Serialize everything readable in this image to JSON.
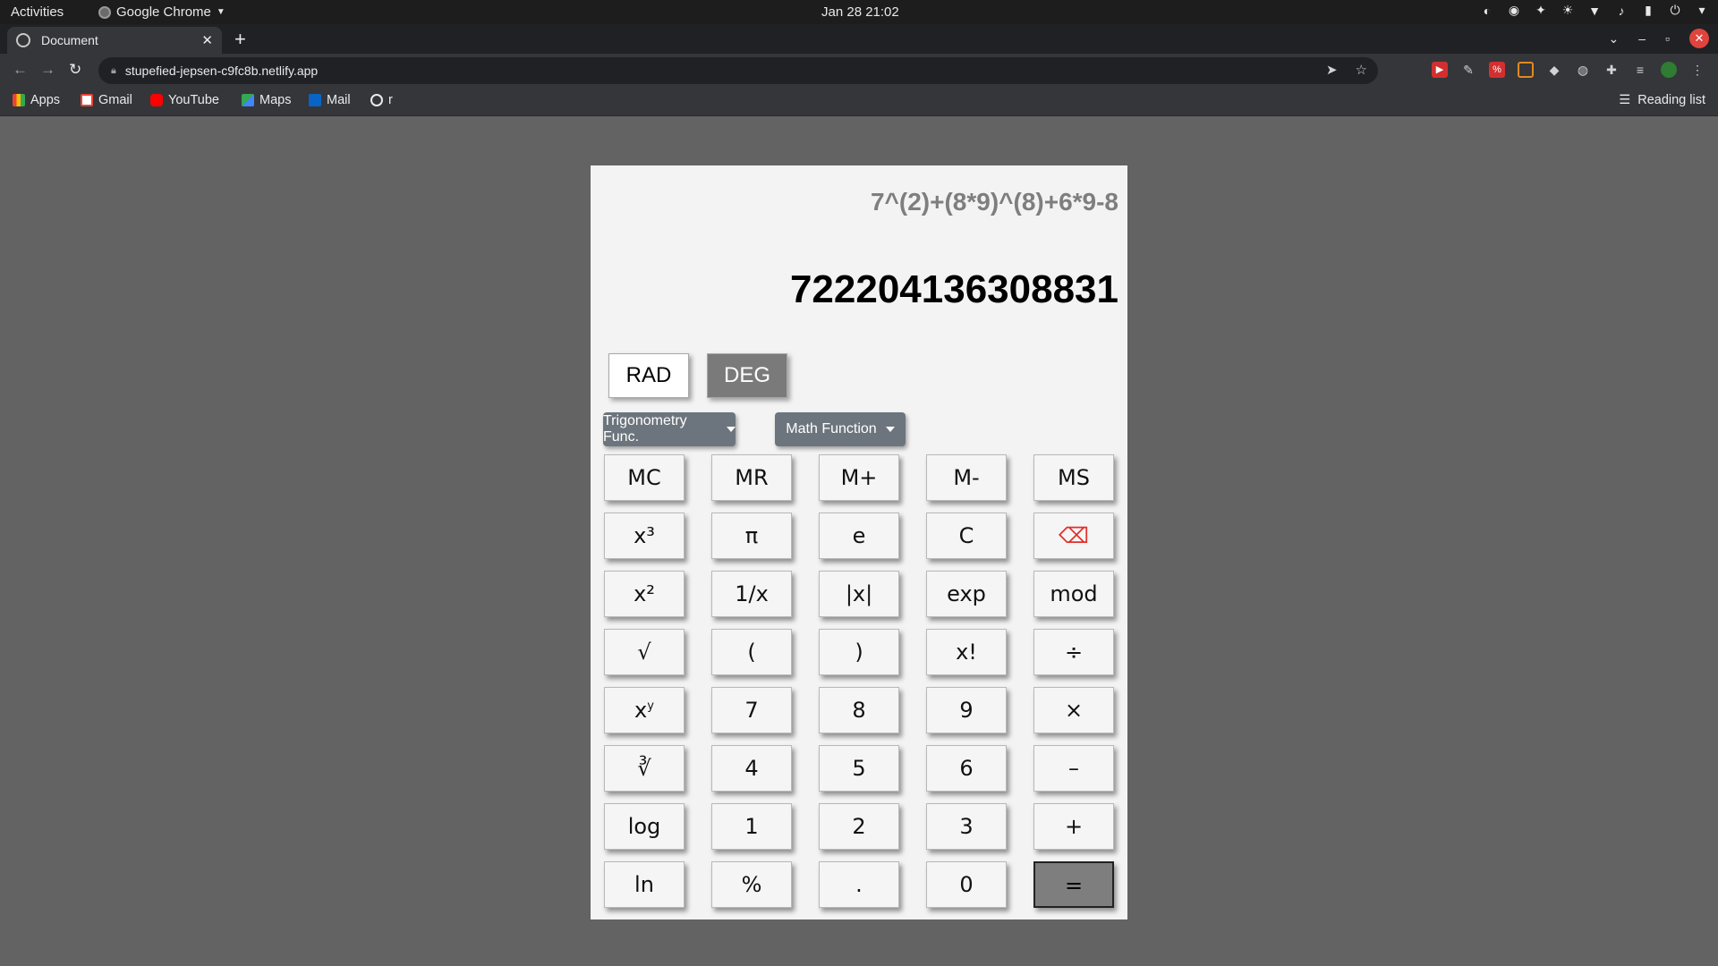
{
  "system_bar": {
    "activities": "Activities",
    "app_name": "Google Chrome",
    "clock": "Jan 28  21:02"
  },
  "browser": {
    "tab_title": "Document",
    "url": "stupefied-jepsen-c9fc8b.netlify.app",
    "bookmarks": [
      "Apps",
      "Gmail",
      "YouTube",
      "Maps",
      "Mail",
      "r"
    ],
    "reading_list": "Reading list"
  },
  "calculator": {
    "expression": "7^(2)+(8*9)^(8)+6*9-8",
    "result": "722204136308831",
    "active_mode": "DEG",
    "modes": {
      "rad": "RAD",
      "deg": "DEG"
    },
    "dropdowns": {
      "trig": "Trigonometry Func.",
      "math": "Math Function"
    },
    "keys": {
      "mc": "MC",
      "mr": "MR",
      "mplus": "M+",
      "mminus": "M-",
      "ms": "MS",
      "cube": "x³",
      "pi": "π",
      "e": "e",
      "clear": "C",
      "backspace": "⌫",
      "square": "x²",
      "reciprocal": "1/x",
      "abs": "|x|",
      "exp": "exp",
      "mod": "mod",
      "sqrt": "√",
      "lparen": "(",
      "rparen": ")",
      "factorial": "x!",
      "divide": "÷",
      "power_base": "x",
      "power_exp": "y",
      "seven": "7",
      "eight": "8",
      "nine": "9",
      "multiply": "×",
      "cbrt": "∛",
      "four": "4",
      "five": "5",
      "six": "6",
      "minus": "–",
      "log": "log",
      "one": "1",
      "two": "2",
      "three": "3",
      "plus": "+",
      "ln": "ln",
      "percent": "%",
      "dot": ".",
      "zero": "0",
      "equals": "="
    }
  }
}
